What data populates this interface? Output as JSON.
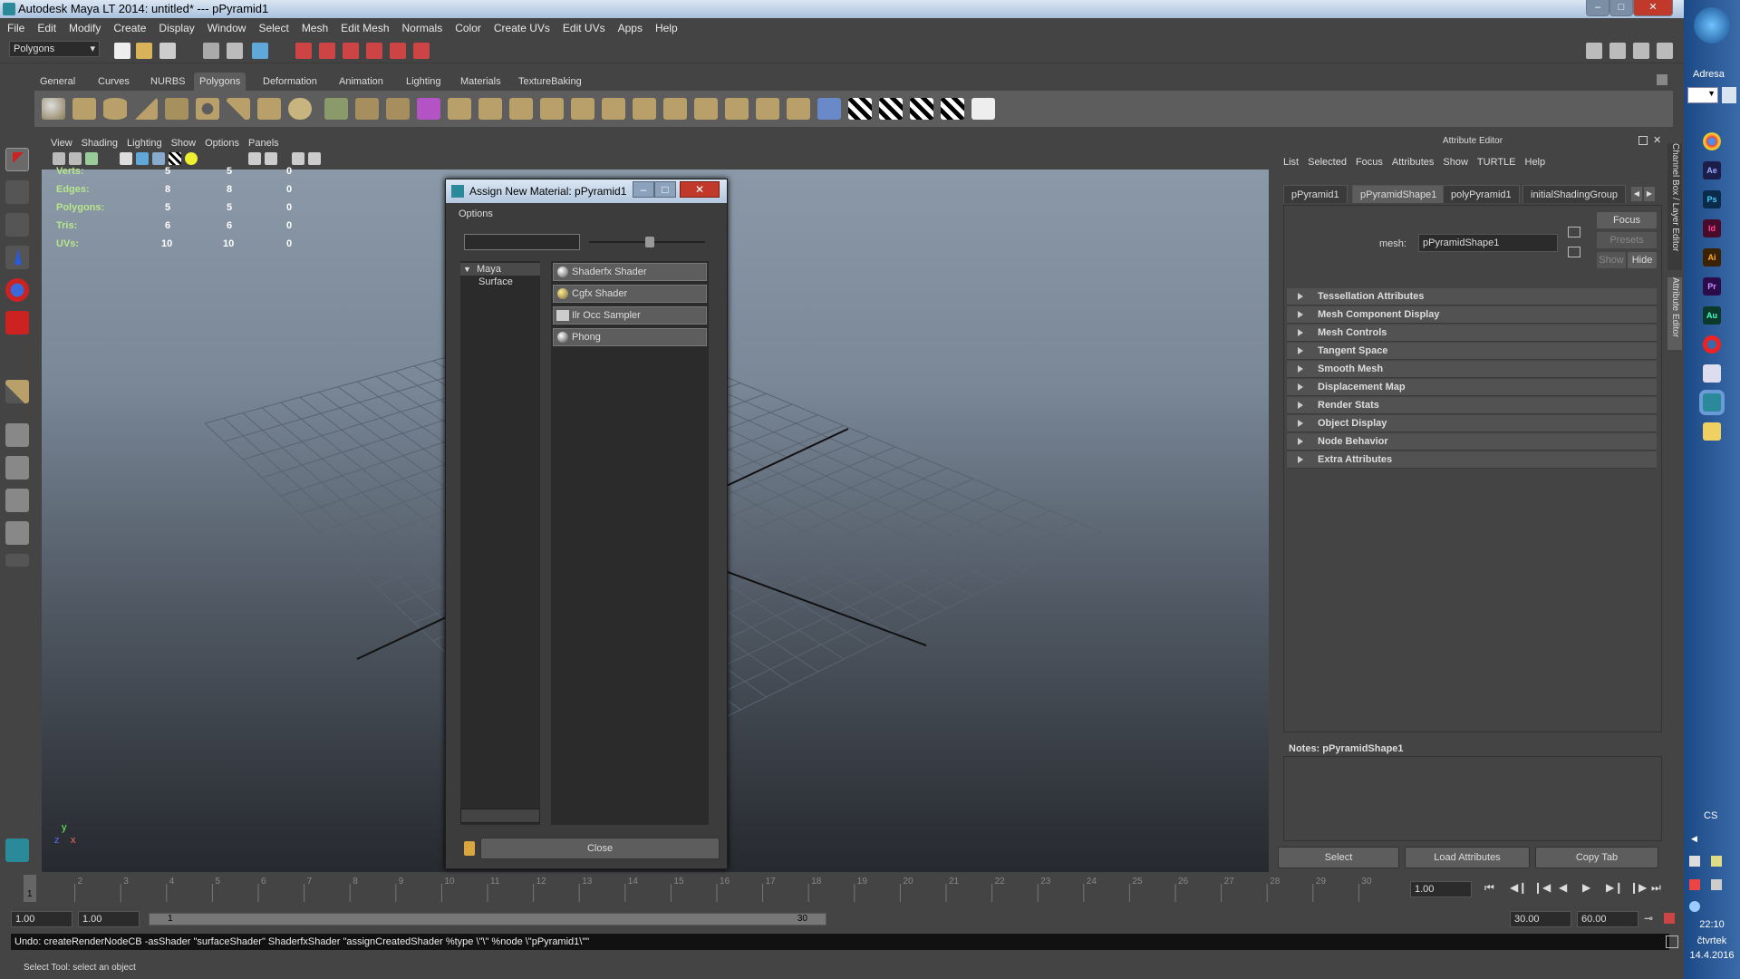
{
  "window": {
    "title": "Autodesk Maya LT 2014: untitled*  ---   pPyramid1"
  },
  "menubar": [
    "File",
    "Edit",
    "Modify",
    "Create",
    "Display",
    "Window",
    "Select",
    "Mesh",
    "Edit Mesh",
    "Normals",
    "Color",
    "Create UVs",
    "Edit UVs",
    "Apps",
    "Help"
  ],
  "status": {
    "mode": "Polygons"
  },
  "shelf": {
    "tabs": [
      "General",
      "Curves",
      "NURBS",
      "Polygons",
      "Deformation",
      "Animation",
      "Lighting",
      "Materials",
      "TextureBaking"
    ],
    "active": "Polygons"
  },
  "viewport": {
    "menu": [
      "View",
      "Shading",
      "Lighting",
      "Show",
      "Options",
      "Panels"
    ],
    "hud": [
      {
        "label": "Verts:",
        "a": "5",
        "b": "5",
        "c": "0"
      },
      {
        "label": "Edges:",
        "a": "8",
        "b": "8",
        "c": "0"
      },
      {
        "label": "Polygons:",
        "a": "5",
        "b": "5",
        "c": "0"
      },
      {
        "label": "Tris:",
        "a": "6",
        "b": "6",
        "c": "0"
      },
      {
        "label": "UVs:",
        "a": "10",
        "b": "10",
        "c": "0"
      }
    ],
    "axis_y": "y",
    "axis_x": "x",
    "axis_z": "z"
  },
  "dialog": {
    "title": "Assign New Material: pPyramid1",
    "options_label": "Options",
    "search_value": "",
    "tree": {
      "root": "Maya",
      "child": "Surface"
    },
    "shaders": [
      "Shaderfx Shader",
      "Cgfx Shader",
      "Ilr Occ Sampler",
      "Phong"
    ],
    "close_label": "Close"
  },
  "attribute_editor": {
    "title": "Attribute Editor",
    "menu": [
      "List",
      "Selected",
      "Focus",
      "Attributes",
      "Show",
      "TURTLE",
      "Help"
    ],
    "tabs": [
      "pPyramid1",
      "pPyramidShape1",
      "polyPyramid1",
      "initialShadingGroup"
    ],
    "active_tab": "pPyramidShape1",
    "mesh_label": "mesh:",
    "mesh_value": "pPyramidShape1",
    "focus_label": "Focus",
    "presets_label": "Presets",
    "show_label": "Show",
    "hide_label": "Hide",
    "sections": [
      "Tessellation Attributes",
      "Mesh Component Display",
      "Mesh Controls",
      "Tangent Space",
      "Smooth Mesh",
      "Displacement Map",
      "Render Stats",
      "Object Display",
      "Node Behavior",
      "Extra Attributes"
    ],
    "notes_label": "Notes:  pPyramidShape1",
    "buttons": [
      "Select",
      "Load Attributes",
      "Copy Tab"
    ],
    "side_tabs": [
      "Channel Box / Layer Editor",
      "Attribute Editor"
    ]
  },
  "timeline": {
    "ticks": [
      "1",
      "2",
      "3",
      "4",
      "5",
      "6",
      "7",
      "8",
      "9",
      "10",
      "11",
      "12",
      "13",
      "14",
      "15",
      "16",
      "17",
      "18",
      "19",
      "20",
      "21",
      "22",
      "23",
      "24",
      "25",
      "26",
      "27",
      "28",
      "29",
      "30"
    ],
    "current_frame": "1",
    "current_field": "1.00"
  },
  "range": {
    "start": "1.00",
    "start2": "1.00",
    "slider_start": "1",
    "slider_end": "30",
    "end": "30.00",
    "end2": "60.00"
  },
  "command_line": "Undo: createRenderNodeCB -asShader \"surfaceShader\" ShaderfxShader \"assignCreatedShader %type \\\"\\\" %node \\\"pPyramid1\\\"\"",
  "help_line": "Select Tool: select an object",
  "taskbar": {
    "address_label": "Adresa",
    "apps": [
      "Ae",
      "Ps",
      "Id",
      "Ai",
      "Pr",
      "Au"
    ],
    "lang": "CS",
    "time": "22:10",
    "day": "čtvrtek",
    "date": "14.4.2016"
  }
}
